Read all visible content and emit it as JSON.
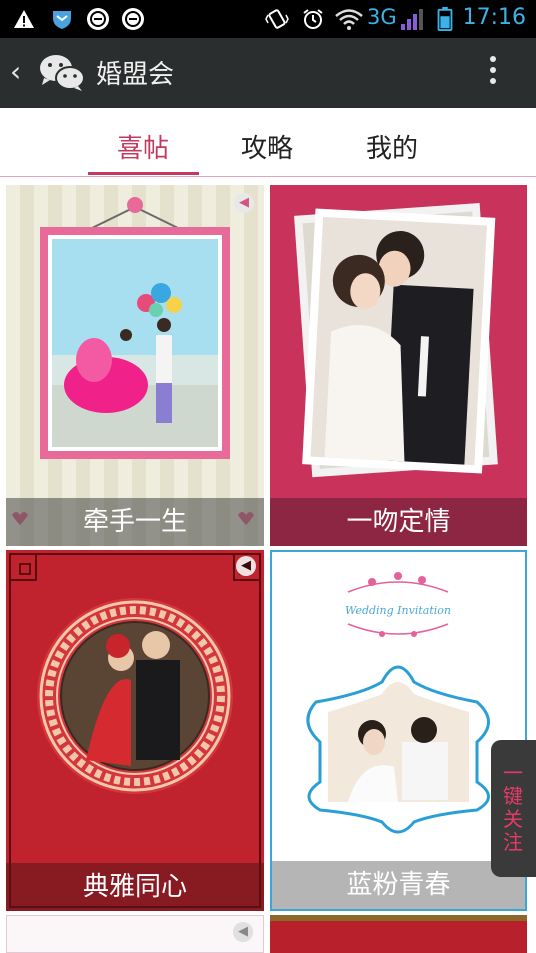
{
  "status_bar": {
    "network": "3G",
    "time": "17:16",
    "icons": [
      "warning-icon",
      "shield-icon",
      "app-notification-icon",
      "app-notification-icon-2",
      "vibrate-icon",
      "alarm-icon",
      "wifi-icon",
      "signal-icon",
      "battery-icon"
    ]
  },
  "app_bar": {
    "title": "婚盟会"
  },
  "tabs": [
    {
      "label": "喜帖",
      "active": true
    },
    {
      "label": "攻略",
      "active": false
    },
    {
      "label": "我的",
      "active": false
    }
  ],
  "cards": [
    {
      "title": "牵手一生"
    },
    {
      "title": "一吻定情"
    },
    {
      "title": "典雅同心"
    },
    {
      "title": "蓝粉青春"
    }
  ],
  "side_button": {
    "label": "一键关注"
  },
  "colors": {
    "accent": "#c23a5f",
    "appbar": "#2b2e2e",
    "status": "#3cb2e6"
  }
}
